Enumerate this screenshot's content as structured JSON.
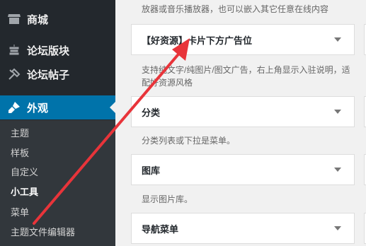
{
  "sidebar": {
    "items": [
      {
        "label": "商城",
        "icon": "store-icon"
      },
      {
        "label": "论坛版块",
        "icon": "forum-section-icon"
      },
      {
        "label": "论坛帖子",
        "icon": "forum-post-icon"
      },
      {
        "label": "外观",
        "icon": "paintbrush-icon"
      }
    ],
    "submenu": [
      "主题",
      "样板",
      "自定义",
      "小工具",
      "菜单",
      "主题文件编辑器"
    ]
  },
  "main": {
    "top_desc": "放器或音乐播放器，也可以嵌入其它任意在线内容",
    "widgets": [
      {
        "title": "【好资源】卡片下方广告位",
        "desc": "支持纯文字/纯图片/图文广告，右上角显示入驻说明，适配好资源风格"
      },
      {
        "title": "分类",
        "desc": "分类列表或下拉是菜单。"
      },
      {
        "title": "图库",
        "desc": "显示图片库。"
      },
      {
        "title": "导航菜单",
        "desc": ""
      }
    ]
  },
  "colors": {
    "sidebar_bg": "#23282d",
    "submenu_bg": "#32373c",
    "active_bg": "#0073aa",
    "arrow": "#e8343a"
  }
}
